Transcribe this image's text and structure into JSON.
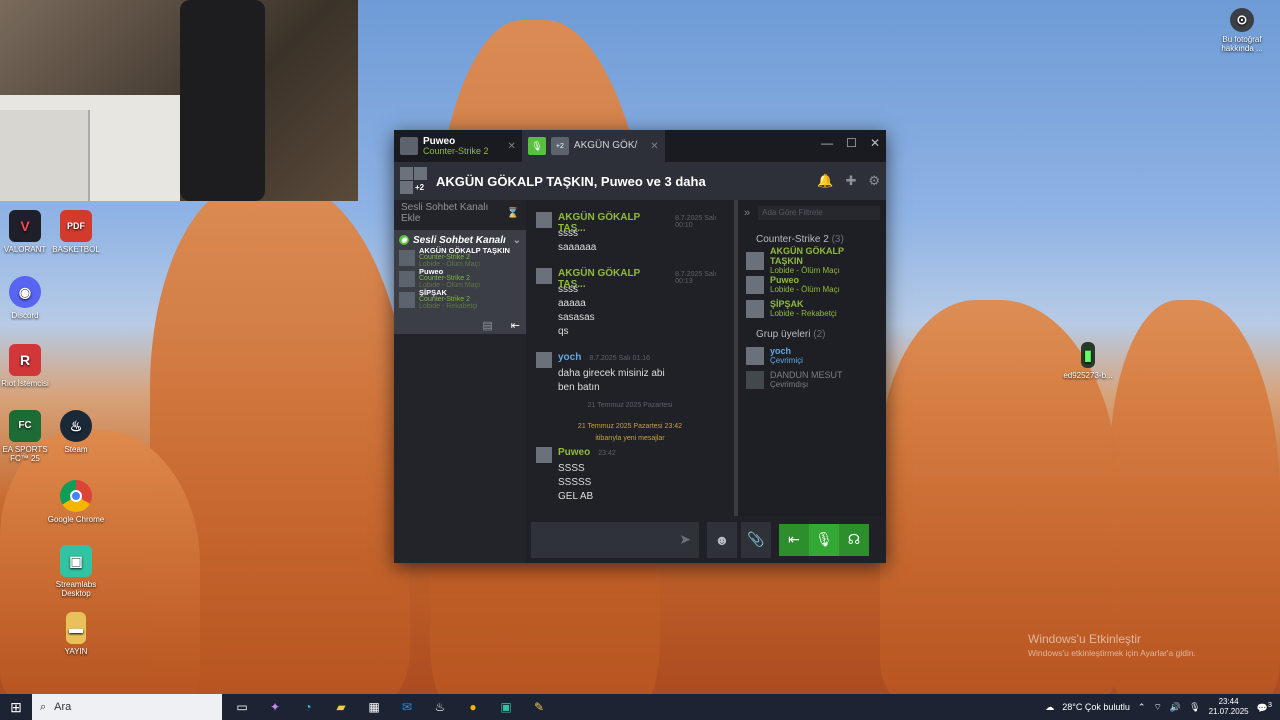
{
  "desktop": {
    "icons": [
      {
        "label": "VALORANT",
        "color": "#1f1f2a",
        "glyph": "V"
      },
      {
        "label": "BASKETBOL",
        "color": "#d23b2c",
        "glyph": "PDF"
      },
      {
        "label": "Discord",
        "color": "#5865f2",
        "glyph": "◉"
      },
      {
        "label": "Riot İstemcisi",
        "color": "#d13639",
        "glyph": "R"
      },
      {
        "label": "EA SPORTS FC™ 25",
        "color": "#1d6c35",
        "glyph": "FC"
      },
      {
        "label": "Steam",
        "color": "#1b2838",
        "glyph": "♨"
      },
      {
        "label": "Google Chrome",
        "color": "#dd4b39",
        "glyph": "●"
      },
      {
        "label": "Streamlabs Desktop",
        "color": "#31c3a2",
        "glyph": "▣"
      },
      {
        "label": "YAYIN",
        "color": "#e8c15a",
        "glyph": "▬"
      },
      {
        "label": "Bu fotoğraf hakkında ...",
        "color": "#3b3f46",
        "glyph": "⊙"
      },
      {
        "label": "ed925273-b...",
        "color": "#2a3a2a",
        "glyph": "▮"
      }
    ],
    "activation": {
      "title": "Windows'u Etkinleştir",
      "sub": "Windows'u etkinleştirmek için Ayarlar'a gidin."
    }
  },
  "steam": {
    "tabs": [
      {
        "name": "Puweo",
        "game": "Counter-Strike 2"
      },
      {
        "name": "AKGÜN GÖK/",
        "badge": "+2"
      }
    ],
    "group_title": "AKGÜN GÖKALP TAŞKIN, Puweo ve 3 daha",
    "group_badge": "+2",
    "add_voice": "Sesli Sohbet Kanalı Ekle",
    "voice_channel": {
      "name": "Sesli Sohbet Kanalı",
      "members": [
        {
          "name": "AKGÜN GÖKALP TAŞKIN",
          "game": "Counter-Strike 2",
          "status": "Lobide - Ölüm Maçı"
        },
        {
          "name": "Puweo",
          "game": "Counter-Strike 2",
          "status": "Lobide - Ölüm Maçı"
        },
        {
          "name": "ŞİPŞAK",
          "game": "Counter-Strike 2",
          "status": "Lobide - Rekabetçi"
        }
      ]
    },
    "messages": [
      {
        "name": "AKGÜN GÖKALP TAŞ...",
        "time": "8.7.2025 Salı 00:10",
        "lines": [
          "ssss",
          "saaaaaa"
        ]
      },
      {
        "name": "AKGÜN GÖKALP TAŞ...",
        "time": "8.7.2025 Salı 00:13",
        "lines": [
          "ssss",
          "aaaaa",
          "sasasas",
          "qs"
        ]
      },
      {
        "name": "yoch",
        "time": "8.7.2025 Salı 01:16",
        "lines": [
          "daha girecek misiniz abi",
          "ben batın"
        ]
      }
    ],
    "divider": "21 Temmuz 2025 Pazartesi",
    "new_messages": {
      "line1": "21 Temmuz 2025 Pazartesi 23:42",
      "line2": "itibarıyla yeni mesajlar"
    },
    "last_message": {
      "name": "Puweo",
      "time": "23:42",
      "lines": [
        "SSSS",
        "SSSSS",
        "GEL AB"
      ]
    },
    "filter_placeholder": "Ada Göre Filtrele",
    "groups": [
      {
        "title": "Counter-Strike 2",
        "count": "(3)"
      },
      {
        "title": "Grup üyeleri",
        "count": "(2)"
      }
    ],
    "members_cs": [
      {
        "name": "AKGÜN GÖKALP TAŞKIN",
        "status": "Lobide - Ölüm Maçı"
      },
      {
        "name": "Puweo",
        "status": "Lobide - Ölüm Maçı"
      },
      {
        "name": "ŞİPŞAK",
        "status": "Lobide - Rekabetçi"
      }
    ],
    "members_group": [
      {
        "name": "yoch",
        "status": "Çevrimiçi"
      },
      {
        "name": "DANDUN MESUT",
        "status": "Çevrimdışı"
      }
    ]
  },
  "taskbar": {
    "search": "Ara",
    "weather": "28°C  Çok bulutlu",
    "time": "23:44",
    "date": "21.07.2025",
    "notif": "3"
  }
}
